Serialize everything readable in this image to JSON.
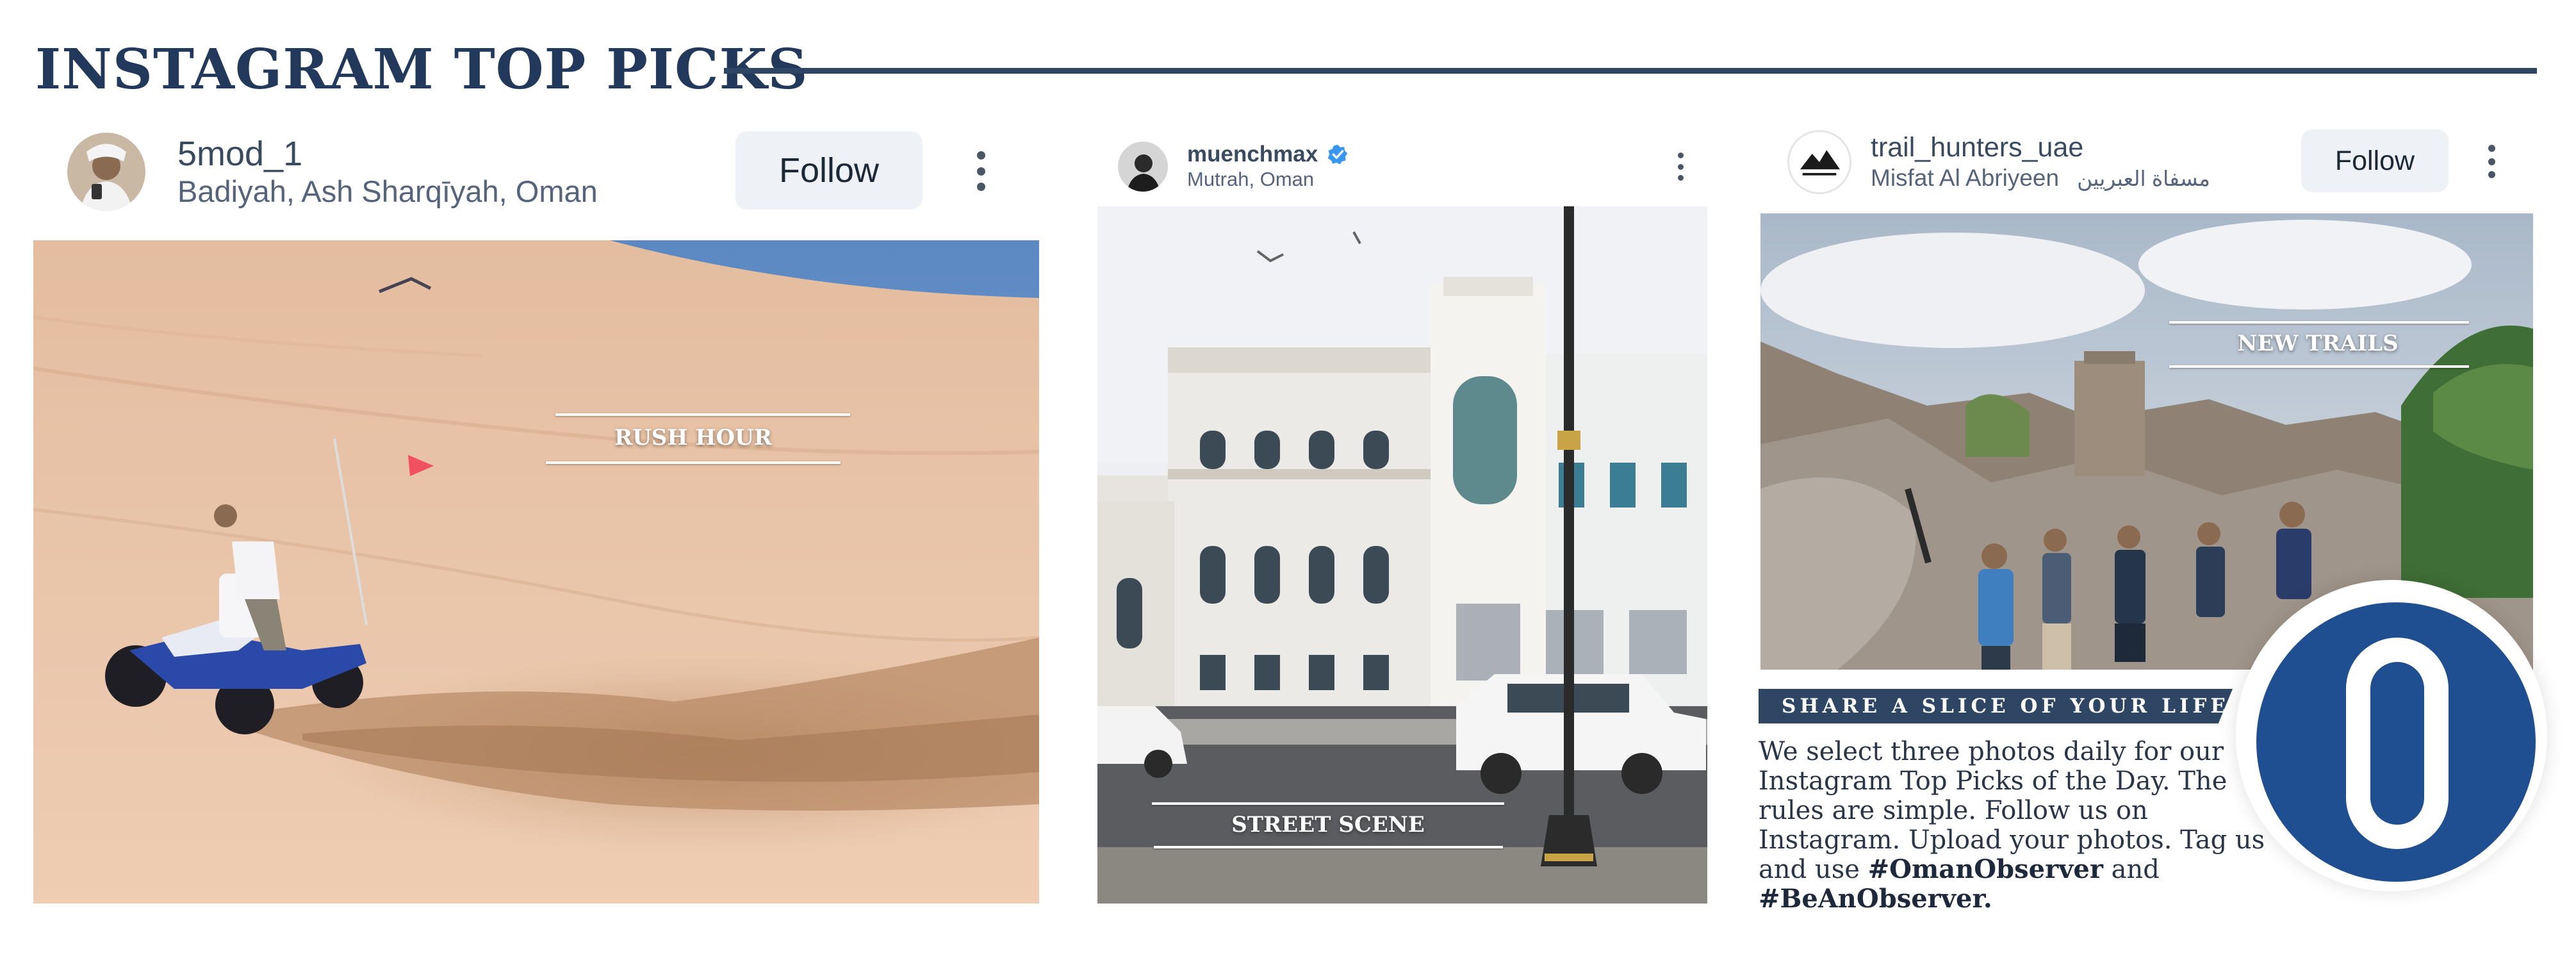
{
  "masthead": {
    "title": "INSTAGRAM TOP PICKS"
  },
  "posts": [
    {
      "handle": "5mod_1",
      "location": "Badiyah, Ash Sharqīyah, Oman",
      "follow_label": "Follow",
      "verified": false,
      "photo_label": "RUSH HOUR"
    },
    {
      "handle": "muenchmax",
      "location": "Mutrah, Oman",
      "follow_label": "",
      "verified": true,
      "photo_label": "STREET SCENE"
    },
    {
      "handle": "trail_hunters_uae",
      "location": "Misfat Al Abriyeen",
      "location_arabic": "مسفاة العبريين",
      "follow_label": "Follow",
      "verified": false,
      "photo_label": "NEW TRAILS"
    }
  ],
  "info": {
    "banner": "SHARE A SLICE OF YOUR LIFE",
    "text_1": "We select three photos daily for our Instagram Top Picks of the Day. The rules are simple. Follow us on Instagram. Upload your photos. Tag us and use ",
    "hashtag_1": "#OmanObserver",
    "text_2": " and ",
    "hashtag_2": "#BeAnObserver.",
    "logo_letter": "O"
  },
  "icons": {
    "verified": "verified-badge-icon",
    "more": "more-vertical-icon",
    "logo": "oman-observer-logo"
  },
  "colors": {
    "navy": "#23395b",
    "logo_blue": "#1f4f91",
    "verified_blue": "#3897f0"
  }
}
